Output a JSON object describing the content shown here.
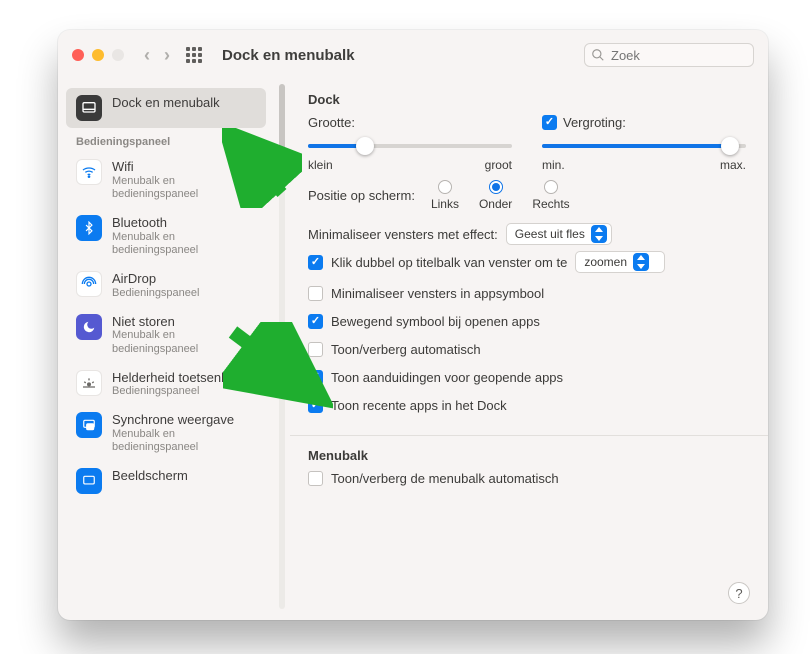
{
  "toolbar": {
    "title": "Dock en menubalk",
    "search_placeholder": "Zoek"
  },
  "sidebar": {
    "section_label": "Bedieningspaneel",
    "items": [
      {
        "label": "Dock en menubalk",
        "sub": ""
      },
      {
        "label": "Wifi",
        "sub": "Menubalk en bedieningspaneel"
      },
      {
        "label": "Bluetooth",
        "sub": "Menubalk en bedieningspaneel"
      },
      {
        "label": "AirDrop",
        "sub": "Bedieningspaneel"
      },
      {
        "label": "Niet storen",
        "sub": "Menubalk en bedieningspaneel"
      },
      {
        "label": "Helderheid toetsenbord",
        "sub": "Bedieningspaneel"
      },
      {
        "label": "Synchrone weergave",
        "sub": "Menubalk en bedieningspaneel"
      },
      {
        "label": "Beeldscherm",
        "sub": ""
      }
    ]
  },
  "dock": {
    "title": "Dock",
    "size_label": "Grootte:",
    "size_min": "klein",
    "size_max": "groot",
    "mag_label": "Vergroting:",
    "mag_min": "min.",
    "mag_max": "max.",
    "position_label": "Positie op scherm:",
    "pos_left": "Links",
    "pos_center": "Onder",
    "pos_right": "Rechts",
    "min_effect_label": "Minimaliseer vensters met effect:",
    "min_effect_value": "Geest uit fles",
    "dbl_label_prefix": "Klik dubbel op titelbalk van venster om te",
    "dbl_value": "zoomen",
    "chk_min_in_icon": "Minimaliseer vensters in appsymbool",
    "chk_bounce": "Bewegend symbool bij openen apps",
    "chk_autohide": "Toon/verberg automatisch",
    "chk_indicators": "Toon aanduidingen voor geopende apps",
    "chk_recent": "Toon recente apps in het Dock"
  },
  "menubar": {
    "title": "Menubalk",
    "chk_autohide": "Toon/verberg de menubalk automatisch"
  }
}
